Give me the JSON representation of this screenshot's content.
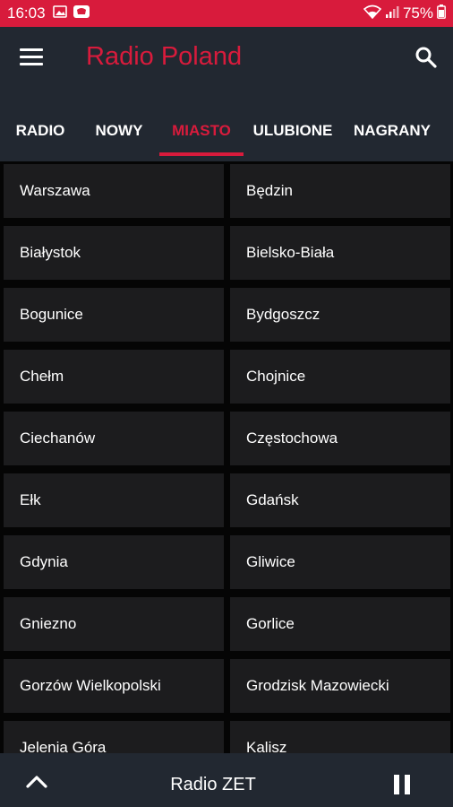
{
  "status_bar": {
    "time": "16:03",
    "battery": "75%"
  },
  "app_bar": {
    "title": "Radio Poland",
    "menu_icon": "hamburger-menu-icon",
    "search_icon": "search-icon"
  },
  "tabs": [
    {
      "label": "RADIO",
      "active": false
    },
    {
      "label": "NOWY",
      "active": false
    },
    {
      "label": "MIASTO",
      "active": true
    },
    {
      "label": "ULUBIONE",
      "active": false
    },
    {
      "label": "NAGRANY",
      "active": false
    }
  ],
  "cities": [
    "Warszawa",
    "Będzin",
    "Białystok",
    "Bielsko-Biała",
    "Bogunice",
    "Bydgoszcz",
    "Chełm",
    "Chojnice",
    "Ciechanów",
    "Częstochowa",
    "Ełk",
    "Gdańsk",
    "Gdynia",
    "Gliwice",
    "Gniezno",
    "Gorlice",
    "Gorzów Wielkopolski",
    "Grodzisk Mazowiecki",
    "Jelenia Góra",
    "Kalisz"
  ],
  "player": {
    "station": "Radio ZET",
    "expand_icon": "chevron-up-icon",
    "pause_icon": "pause-icon"
  },
  "colors": {
    "accent": "#d81b3c",
    "toolbar": "#222831",
    "tile": "#1c1c1e"
  }
}
